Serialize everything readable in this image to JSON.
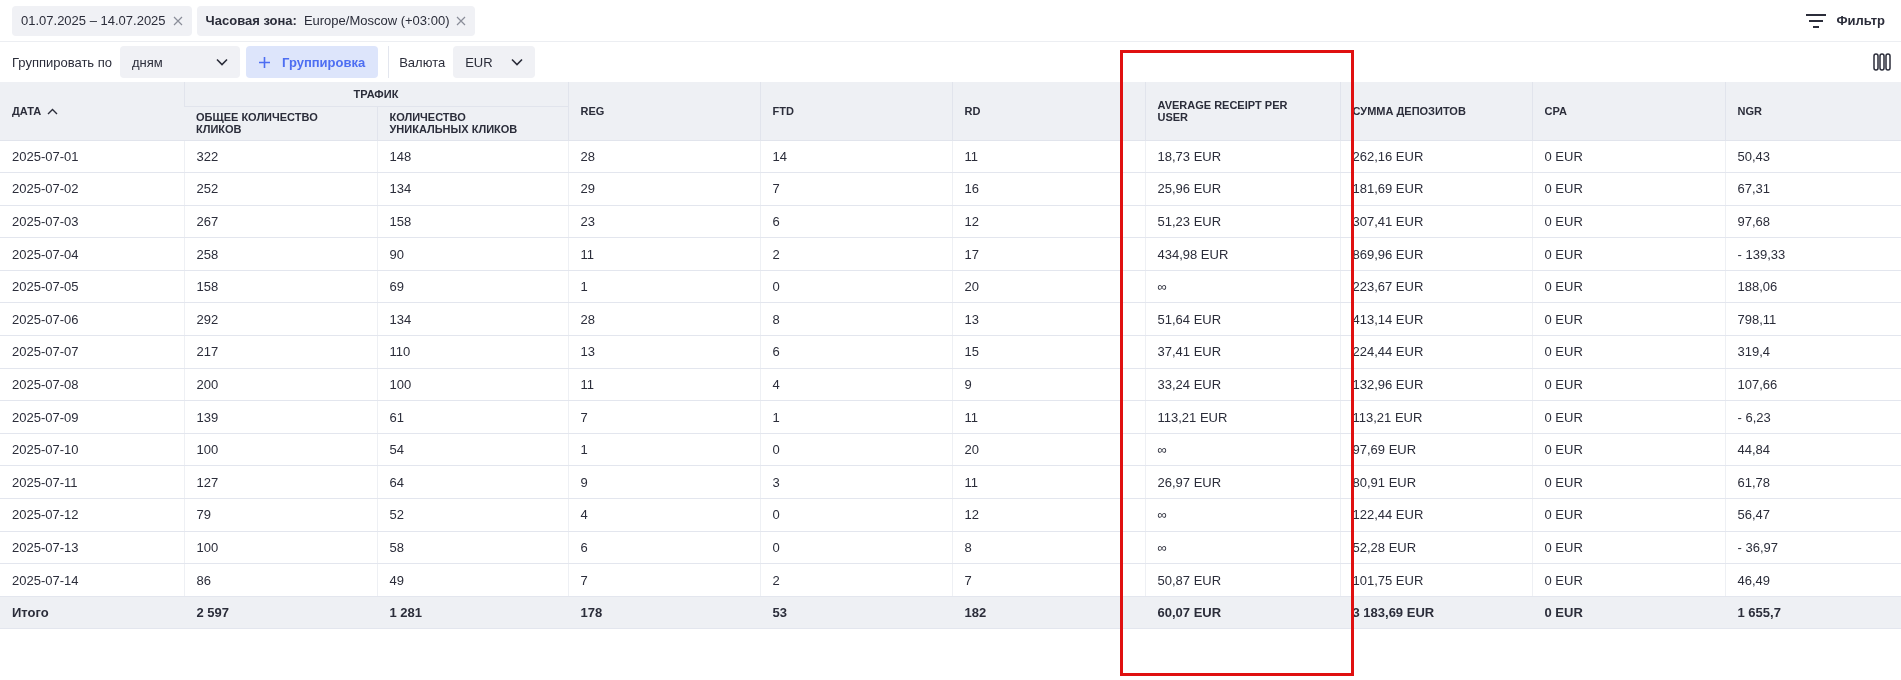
{
  "chips": [
    {
      "label": "01.07.2025 – 14.07.2025"
    },
    {
      "label": "Часовая зона:",
      "value": "Europe/Moscow (+03:00)"
    }
  ],
  "filter_button": {
    "label": "Фильтр"
  },
  "toolbar": {
    "group_label": "Группировать по",
    "group_select": "дням",
    "add_group_button": "Группировка",
    "currency_label": "Валюта",
    "currency_select": "EUR"
  },
  "table": {
    "group_header": {
      "label": "ТРАФИК"
    },
    "columns": [
      {
        "label": "ДАТА",
        "sorted_ascending": true
      },
      {
        "label": "ОБЩЕЕ КОЛИЧЕСТВО КЛИКОВ",
        "grouped": true
      },
      {
        "label": "КОЛИЧЕСТВО УНИКАЛЬНЫХ КЛИКОВ",
        "grouped": true
      },
      {
        "label": "REG"
      },
      {
        "label": "FTD"
      },
      {
        "label": "RD"
      },
      {
        "label": "AVERAGE RECEIPT PER USER",
        "highlighted": true
      },
      {
        "label": "СУММА ДЕПОЗИТОВ"
      },
      {
        "label": "CPA"
      },
      {
        "label": "NGR"
      }
    ],
    "rows": [
      [
        "2025-07-01",
        "322",
        "148",
        "28",
        "14",
        "11",
        "18,73 EUR",
        "262,16 EUR",
        "0 EUR",
        "50,43"
      ],
      [
        "2025-07-02",
        "252",
        "134",
        "29",
        "7",
        "16",
        "25,96 EUR",
        "181,69 EUR",
        "0 EUR",
        "67,31"
      ],
      [
        "2025-07-03",
        "267",
        "158",
        "23",
        "6",
        "12",
        "51,23 EUR",
        "307,41 EUR",
        "0 EUR",
        "97,68"
      ],
      [
        "2025-07-04",
        "258",
        "90",
        "11",
        "2",
        "17",
        "434,98 EUR",
        "869,96 EUR",
        "0 EUR",
        "- 139,33"
      ],
      [
        "2025-07-05",
        "158",
        "69",
        "1",
        "0",
        "20",
        "∞",
        "223,67 EUR",
        "0 EUR",
        "188,06"
      ],
      [
        "2025-07-06",
        "292",
        "134",
        "28",
        "8",
        "13",
        "51,64 EUR",
        "413,14 EUR",
        "0 EUR",
        "798,11"
      ],
      [
        "2025-07-07",
        "217",
        "110",
        "13",
        "6",
        "15",
        "37,41 EUR",
        "224,44 EUR",
        "0 EUR",
        "319,4"
      ],
      [
        "2025-07-08",
        "200",
        "100",
        "11",
        "4",
        "9",
        "33,24 EUR",
        "132,96 EUR",
        "0 EUR",
        "107,66"
      ],
      [
        "2025-07-09",
        "139",
        "61",
        "7",
        "1",
        "11",
        "113,21 EUR",
        "113,21 EUR",
        "0 EUR",
        "- 6,23"
      ],
      [
        "2025-07-10",
        "100",
        "54",
        "1",
        "0",
        "20",
        "∞",
        "97,69 EUR",
        "0 EUR",
        "44,84"
      ],
      [
        "2025-07-11",
        "127",
        "64",
        "9",
        "3",
        "11",
        "26,97 EUR",
        "80,91 EUR",
        "0 EUR",
        "61,78"
      ],
      [
        "2025-07-12",
        "79",
        "52",
        "4",
        "0",
        "12",
        "∞",
        "122,44 EUR",
        "0 EUR",
        "56,47"
      ],
      [
        "2025-07-13",
        "100",
        "58",
        "6",
        "0",
        "8",
        "∞",
        "52,28 EUR",
        "0 EUR",
        "- 36,97"
      ],
      [
        "2025-07-14",
        "86",
        "49",
        "7",
        "2",
        "7",
        "50,87 EUR",
        "101,75 EUR",
        "0 EUR",
        "46,49"
      ]
    ],
    "total": [
      "Итого",
      "2 597",
      "1 281",
      "178",
      "53",
      "182",
      "60,07 EUR",
      "3 183,69 EUR",
      "0 EUR",
      "1 655,7"
    ]
  }
}
